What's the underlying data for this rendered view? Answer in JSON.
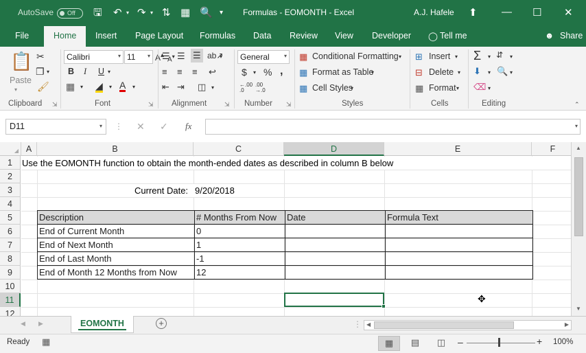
{
  "titlebar": {
    "autosave_label": "AutoSave",
    "autosave_state": "Off",
    "title": "Formulas - EOMONTH  -  Excel",
    "user": "A.J. Hafele",
    "icons": [
      "save-icon",
      "undo-icon",
      "redo-icon",
      "sort-icon",
      "print-preview-icon",
      "customize-icon",
      "ribbon-display-icon",
      "minimize-icon",
      "maximize-icon",
      "close-icon"
    ]
  },
  "tabs": [
    "File",
    "Home",
    "Insert",
    "Page Layout",
    "Formulas",
    "Data",
    "Review",
    "View",
    "Developer",
    "Tell me",
    "Share"
  ],
  "ribbon": {
    "clipboard": {
      "paste": "Paste",
      "label": "Clipboard"
    },
    "font": {
      "name": "Calibri",
      "size": "11",
      "label": "Font",
      "bold": "B",
      "italic": "I",
      "underline": "U"
    },
    "alignment": {
      "label": "Alignment"
    },
    "number": {
      "format": "General",
      "currency": "$",
      "percent": "%",
      "comma": ",",
      "inc_decimal": ".00",
      "dec_decimal": ".00",
      "label": "Number"
    },
    "styles": {
      "conditional": "Conditional Formatting",
      "table": "Format as Table",
      "cell": "Cell Styles",
      "label": "Styles"
    },
    "cells": {
      "insert": "Insert",
      "delete": "Delete",
      "format": "Format",
      "label": "Cells"
    },
    "editing": {
      "label": "Editing"
    }
  },
  "formula_bar": {
    "name_box": "D11",
    "fx": "fx",
    "value": ""
  },
  "columns": [
    "A",
    "B",
    "C",
    "D",
    "E",
    "F"
  ],
  "rows": [
    "1",
    "2",
    "3",
    "4",
    "5",
    "6",
    "7",
    "8",
    "9",
    "10",
    "11",
    "12"
  ],
  "cells": {
    "a1": "Use the EOMONTH function to obtain the month-ended dates as described in column B below",
    "current_date_label": "Current Date:",
    "current_date_value": "9/20/2018"
  },
  "table": {
    "headers": [
      "Description",
      "# Months From Now",
      "Date",
      "Formula Text"
    ],
    "rows": [
      [
        "End of Current Month",
        "0",
        "",
        ""
      ],
      [
        "End of Next Month",
        "1",
        "",
        ""
      ],
      [
        "End of Last Month",
        "-1",
        "",
        ""
      ],
      [
        "End of Month 12 Months from Now",
        "12",
        "",
        ""
      ]
    ]
  },
  "sheet_tabs": [
    "EOMONTH"
  ],
  "status": {
    "ready": "Ready",
    "zoom": "100%"
  }
}
